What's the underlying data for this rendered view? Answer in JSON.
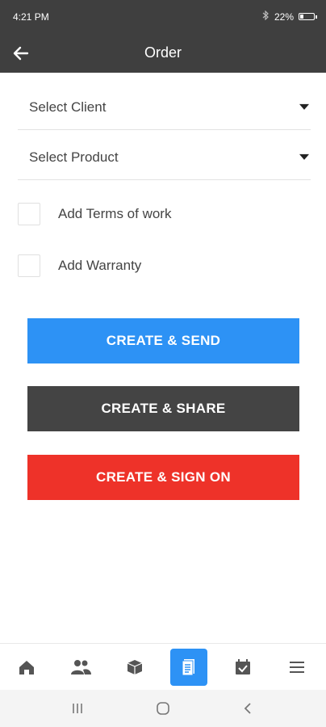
{
  "status_bar": {
    "time": "4:21 PM",
    "battery_text": "22%",
    "battery_level": 0.22,
    "icons": [
      "bluetooth-icon",
      "battery-icon"
    ]
  },
  "app_bar": {
    "title": "Order",
    "back_icon": "back-arrow-icon"
  },
  "form": {
    "client_select": {
      "label": "Select Client"
    },
    "product_select": {
      "label": "Select Product"
    },
    "terms_checkbox": {
      "label": "Add Terms of work",
      "checked": false
    },
    "warranty_checkbox": {
      "label": "Add Warranty",
      "checked": false
    }
  },
  "buttons": {
    "send": {
      "label": "CREATE & SEND",
      "color": "#2d92f5"
    },
    "share": {
      "label": "CREATE & SHARE",
      "color": "#444444"
    },
    "sign": {
      "label": "CREATE & SIGN ON",
      "color": "#ee3229"
    }
  },
  "bottom_nav": {
    "items": [
      {
        "icon": "home-icon",
        "active": false
      },
      {
        "icon": "clients-icon",
        "active": false
      },
      {
        "icon": "products-icon",
        "active": false
      },
      {
        "icon": "orders-icon",
        "active": true
      },
      {
        "icon": "tasks-icon",
        "active": false
      },
      {
        "icon": "menu-icon",
        "active": false
      }
    ],
    "active_color": "#2d92f5"
  },
  "system_nav": {
    "icons": [
      "recent-apps-icon",
      "home-circle-icon",
      "back-chevron-icon"
    ]
  }
}
